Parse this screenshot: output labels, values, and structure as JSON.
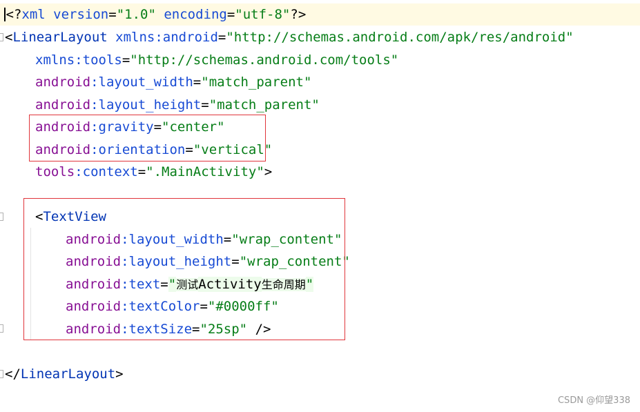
{
  "code_lines": [
    {
      "parts": [
        "<?",
        "xml version",
        "=",
        "\"1.0\"",
        " encoding",
        "=",
        "\"utf-8\"",
        "?>"
      ]
    },
    {
      "parts": [
        "<",
        "LinearLayout",
        " xmlns:android",
        "=",
        "\"http://schemas.android.com/apk/res/android\""
      ]
    },
    {
      "parts": [
        "xmlns:tools",
        "=",
        "\"http://schemas.android.com/tools\""
      ]
    },
    {
      "parts": [
        "android",
        ":layout_width",
        "=",
        "\"match_parent\""
      ]
    },
    {
      "parts": [
        "android",
        ":layout_height",
        "=",
        "\"match_parent\""
      ]
    },
    {
      "parts": [
        "android",
        ":gravity",
        "=",
        "\"center\""
      ]
    },
    {
      "parts": [
        "android",
        ":orientation",
        "=",
        "\"vertical\""
      ]
    },
    {
      "parts": [
        "tools",
        ":context",
        "=",
        "\".MainActivity\"",
        ">"
      ]
    },
    {
      "parts": []
    },
    {
      "parts": [
        "<",
        "TextView"
      ]
    },
    {
      "parts": [
        "android",
        ":layout_width",
        "=",
        "\"wrap_content\""
      ]
    },
    {
      "parts": [
        "android",
        ":layout_height",
        "=",
        "\"wrap_content\""
      ]
    },
    {
      "parts": [
        "android",
        ":text",
        "=",
        "\"",
        "测试",
        "Activity",
        "生命周期",
        "\""
      ]
    },
    {
      "parts": [
        "android",
        ":textColor",
        "=",
        "\"#0000ff\""
      ]
    },
    {
      "parts": [
        "android",
        ":textSize",
        "=",
        "\"25sp\"",
        " />"
      ]
    },
    {
      "parts": []
    },
    {
      "parts": [
        "</",
        "LinearLayout",
        ">"
      ]
    }
  ],
  "highlight_color": "#e0343a",
  "watermark": "CSDN @仰望338"
}
